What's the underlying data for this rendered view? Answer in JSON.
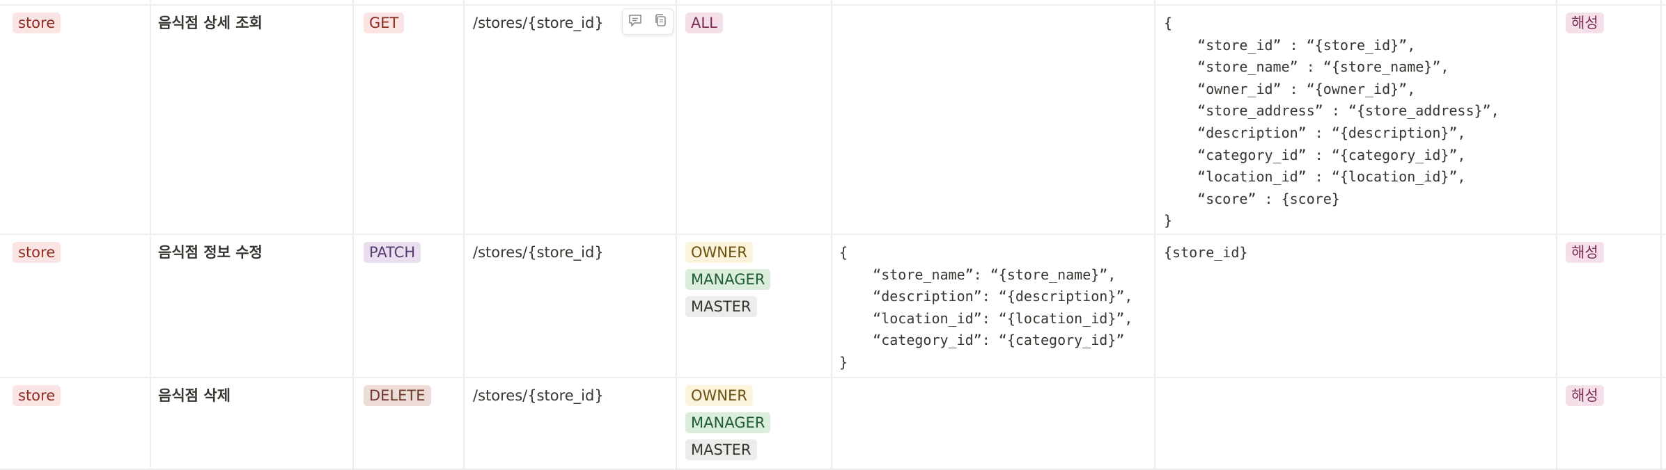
{
  "rows": [
    {
      "domain": "store",
      "name": "음식점 상세 조회",
      "method": "GET",
      "path": "/stores/{store_id}",
      "roles": [
        "ALL"
      ],
      "request": "",
      "response": "{\n    “store_id” : “{store_id}”,\n    “store_name” : “{store_name}”,\n    “owner_id” : “{owner_id}”,\n    “store_address” : “{store_address}”,\n    “description” : “{description}”,\n    “category_id” : “{category_id}”,\n    “location_id” : “{location_id}”,\n    “score” : {score}\n}",
      "assignee": "해성"
    },
    {
      "domain": "store",
      "name": "음식점 정보 수정",
      "method": "PATCH",
      "path": "/stores/{store_id}",
      "roles": [
        "OWNER",
        "MANAGER",
        "MASTER"
      ],
      "request": "{\n    “store_name”: “{store_name}”,\n    “description”: “{description}”,\n    “location_id”: “{location_id}”,\n    “category_id”: “{category_id}”\n}",
      "response": "{store_id}",
      "assignee": "해성"
    },
    {
      "domain": "store",
      "name": "음식점 삭제",
      "method": "DELETE",
      "path": "/stores/{store_id}",
      "roles": [
        "OWNER",
        "MANAGER",
        "MASTER"
      ],
      "request": "",
      "response": "",
      "assignee": "해성"
    }
  ],
  "hover_tools": {
    "icons": [
      "comment-icon",
      "copy-icon"
    ]
  },
  "colors": {
    "grid_line": "#ededec",
    "text": "#37352f",
    "tag_red": "#fbe4e4",
    "tag_purple": "#e8deee",
    "tag_brown": "#eedcd8",
    "tag_pink": "#f5e0e9",
    "tag_yellow": "#fbf3db",
    "tag_green": "#dbeddb",
    "tag_gray": "#ececeb"
  }
}
